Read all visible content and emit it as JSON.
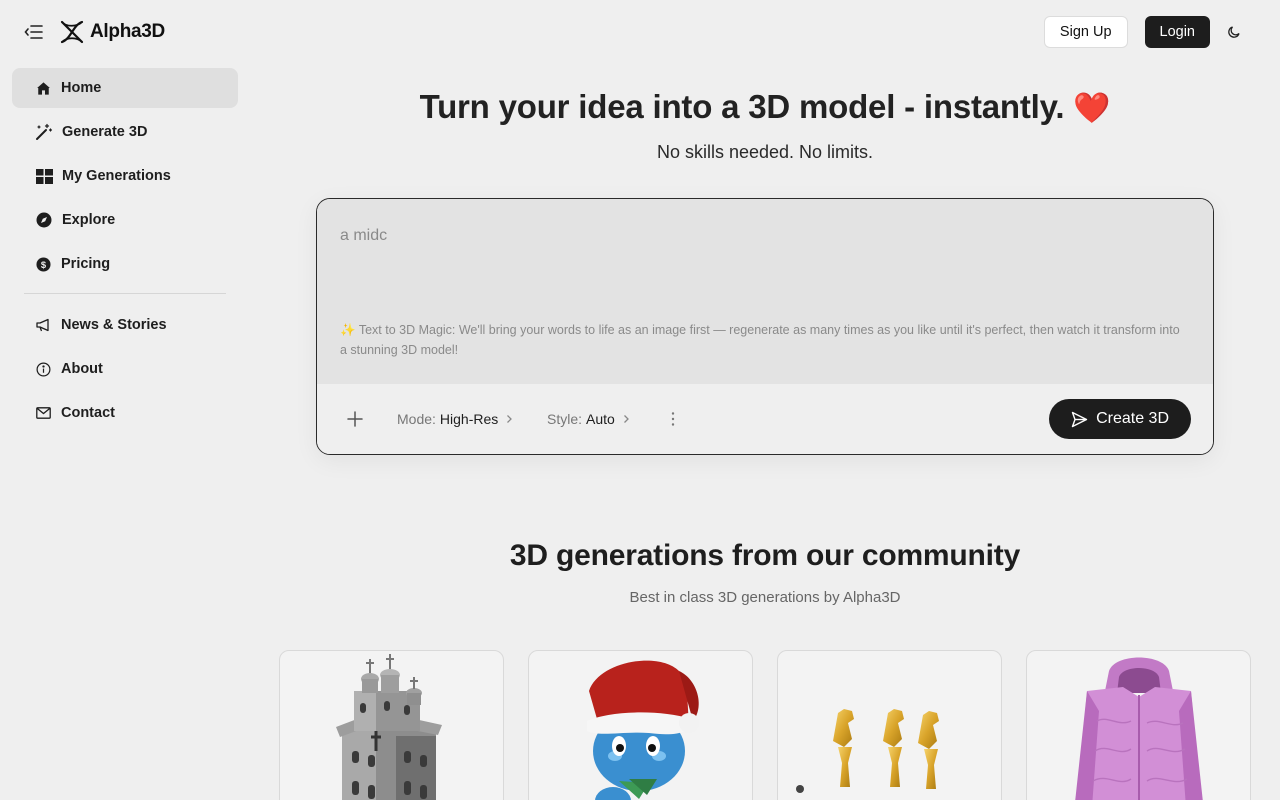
{
  "brand": {
    "name": "Alpha3D"
  },
  "header": {
    "signup_label": "Sign Up",
    "login_label": "Login"
  },
  "sidebar": {
    "items": [
      {
        "label": "Home",
        "icon": "home-icon",
        "active": true
      },
      {
        "label": "Generate 3D",
        "icon": "magic-wand-icon"
      },
      {
        "label": "My Generations",
        "icon": "grid-icon"
      },
      {
        "label": "Explore",
        "icon": "compass-icon"
      },
      {
        "label": "Pricing",
        "icon": "dollar-icon"
      }
    ],
    "secondary": [
      {
        "label": "News & Stories",
        "icon": "megaphone-icon"
      },
      {
        "label": "About",
        "icon": "info-icon"
      },
      {
        "label": "Contact",
        "icon": "mail-icon"
      }
    ]
  },
  "hero": {
    "title": "Turn your idea into a 3D model - instantly.",
    "title_emoji": "❤️",
    "subtitle": "No skills needed. No limits."
  },
  "prompt": {
    "value": "a midc",
    "hint_icon": "✨",
    "hint": "Text to 3D Magic: We'll bring your words to life as an image first — regenerate as many times as you like until it's perfect, then watch it transform into a stunning 3D model!",
    "mode_label": "Mode:",
    "mode_value": "High-Res",
    "style_label": "Style:",
    "style_value": "Auto",
    "create_label": "Create 3D"
  },
  "community": {
    "title": "3D generations from our community",
    "subtitle": "Best in class 3D generations by Alpha3D",
    "cards": [
      {
        "subject": "church-tower-model"
      },
      {
        "subject": "cat-santa-hat-model"
      },
      {
        "subject": "golden-horse-trophies-model"
      },
      {
        "subject": "pink-puffer-jacket-model"
      }
    ]
  },
  "colors": {
    "accent_dark": "#1d1d1d",
    "background": "#efefef",
    "heart": "#e32626"
  }
}
